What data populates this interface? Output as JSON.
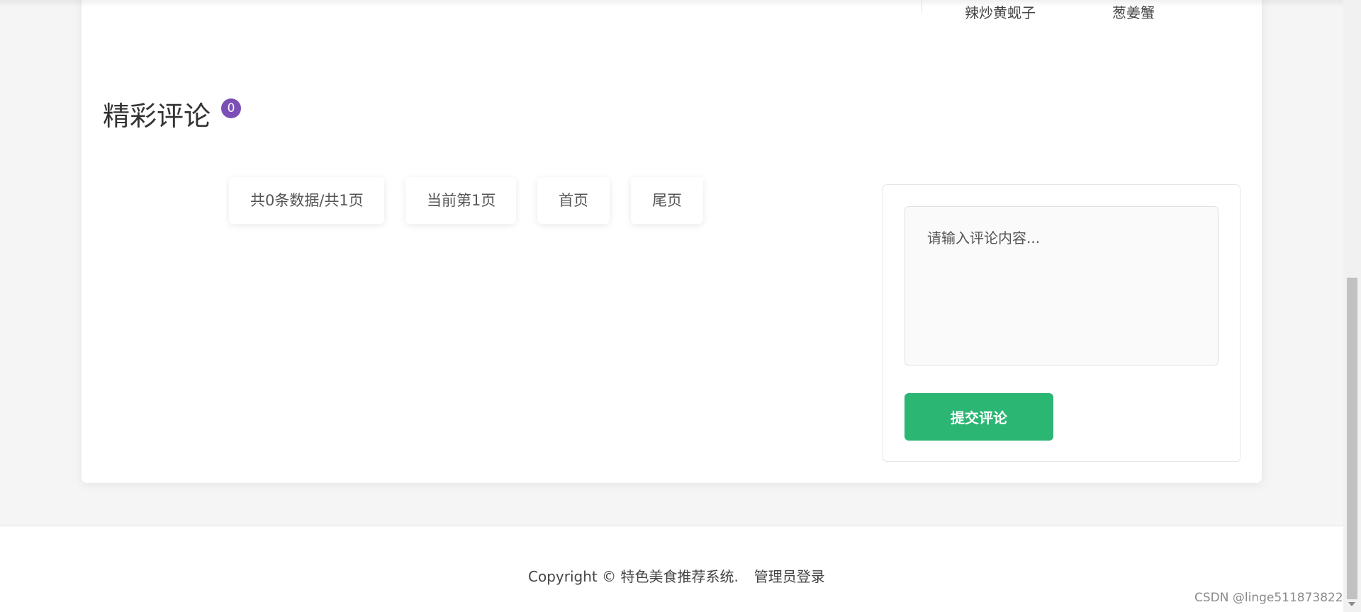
{
  "recommend": {
    "items": [
      "辣炒黄蚬子",
      "葱姜蟹"
    ]
  },
  "comments": {
    "title": "精彩评论",
    "count": "0"
  },
  "pagination": {
    "summary": "共0条数据/共1页",
    "current": "当前第1页",
    "first": "首页",
    "last": "尾页"
  },
  "comment_form": {
    "placeholder": "请输入评论内容...",
    "submit_label": "提交评论"
  },
  "footer": {
    "copyright": "Copyright © 特色美食推荐系统.",
    "admin_link": "管理员登录"
  },
  "watermark": "CSDN @linge511873822",
  "colors": {
    "accent_green": "#2bb673",
    "badge_purple": "#7b4fb6"
  }
}
